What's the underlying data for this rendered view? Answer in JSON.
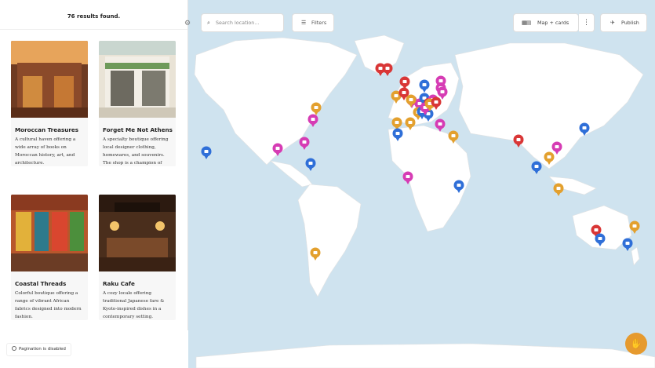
{
  "sidebar": {
    "results_text": "76 results found.",
    "cards": [
      {
        "title": "Moroccan Treasures",
        "description": "A cultural haven offering a wide array of books on Moroccan history, art, and architecture."
      },
      {
        "title": "Forget Me Not Athens",
        "description": "A specialty boutique offering local designer clothing, homewares, and souvenirs. The shop is a champion of Greek design and manufacture."
      },
      {
        "title": "Coastal Threads",
        "description": "Colorful boutique offering a range of vibrant African fabrics designed into modern fashion."
      },
      {
        "title": "Raku Cafe",
        "description": "A cozy locale offering traditional Japanese fare & Kyoto-inspired dishes in a contemporary setting."
      }
    ],
    "pagination_note": "Pagination is disabled"
  },
  "toolbar": {
    "search_placeholder": "Search location...",
    "filters_label": "Filters",
    "view_mode_label": "Map + cards",
    "publish_label": "Publish"
  },
  "icons": {
    "settings": "gear-icon",
    "search": "search-icon",
    "filters": "filter-icon",
    "view": "map-cards-icon",
    "more": "kebab-icon",
    "publish": "rocket-icon",
    "help": "hand-wave-icon"
  },
  "colors": {
    "pin_red": "#d93636",
    "pin_blue": "#2f6fd8",
    "pin_orange": "#e3a02e",
    "pin_magenta": "#d63cb4",
    "map_water": "#cfe3ef",
    "map_land": "#ffffff",
    "help_button": "#e69a2e"
  },
  "map_pins": [
    {
      "color": "red"
    },
    {
      "color": "red"
    },
    {
      "color": "red"
    },
    {
      "color": "blue"
    },
    {
      "color": "magenta"
    },
    {
      "color": "orange"
    },
    {
      "color": "red"
    },
    {
      "color": "magenta"
    },
    {
      "color": "magenta"
    },
    {
      "color": "blue"
    },
    {
      "color": "red"
    },
    {
      "color": "magenta"
    },
    {
      "color": "orange"
    },
    {
      "color": "blue"
    },
    {
      "color": "magenta"
    },
    {
      "color": "orange"
    },
    {
      "color": "blue"
    },
    {
      "color": "magenta"
    },
    {
      "color": "orange"
    },
    {
      "color": "red"
    },
    {
      "color": "orange"
    },
    {
      "color": "magenta"
    },
    {
      "color": "orange"
    },
    {
      "color": "orange"
    },
    {
      "color": "magenta"
    },
    {
      "color": "blue"
    },
    {
      "color": "magenta"
    },
    {
      "color": "blue"
    },
    {
      "color": "orange"
    },
    {
      "color": "magenta"
    },
    {
      "color": "blue"
    },
    {
      "color": "magenta"
    },
    {
      "color": "blue"
    },
    {
      "color": "red"
    },
    {
      "color": "magenta"
    },
    {
      "color": "orange"
    },
    {
      "color": "blue"
    },
    {
      "color": "orange"
    },
    {
      "color": "blue"
    },
    {
      "color": "magenta"
    },
    {
      "color": "orange"
    },
    {
      "color": "red"
    },
    {
      "color": "blue"
    },
    {
      "color": "orange"
    },
    {
      "color": "blue"
    }
  ]
}
